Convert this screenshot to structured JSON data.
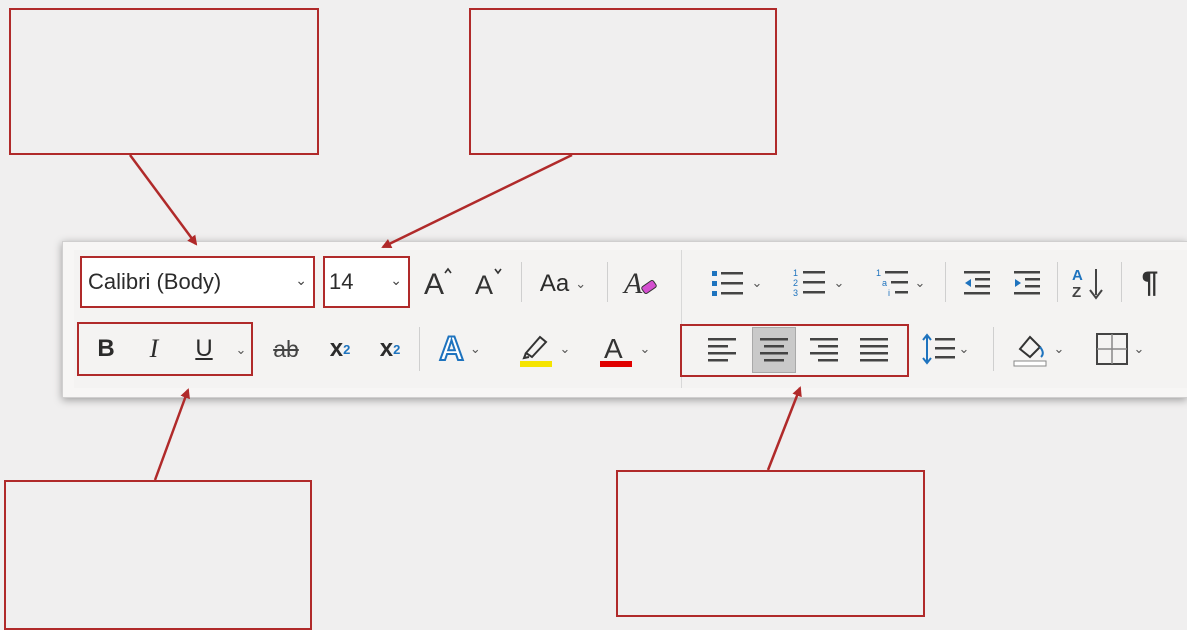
{
  "font": {
    "name": "Calibri (Body)",
    "size": "14"
  },
  "buttons": {
    "bold": "B",
    "italic": "I",
    "underline": "U",
    "strikethrough": "ab",
    "subscript": "x",
    "subscript_mark": "2",
    "superscript": "x",
    "superscript_mark": "2",
    "change_case": "Aa",
    "grow_font": "A",
    "shrink_font": "A",
    "text_effects": "A",
    "font_color": "A",
    "show_marks": "¶"
  },
  "colors": {
    "callout_border": "#b02a2a",
    "accent_blue": "#1e73be",
    "highlight_yellow": "#f5e400",
    "font_color_red": "#e00000"
  },
  "icons": [
    "chevron-down-icon",
    "grow-font-icon",
    "shrink-font-icon",
    "change-case-icon",
    "clear-formatting-icon",
    "bullets-icon",
    "numbering-icon",
    "multilevel-list-icon",
    "decrease-indent-icon",
    "increase-indent-icon",
    "sort-icon",
    "show-marks-icon",
    "strikethrough-icon",
    "subscript-icon",
    "superscript-icon",
    "text-effects-icon",
    "highlight-icon",
    "font-color-icon",
    "align-left-icon",
    "align-center-icon",
    "align-right-icon",
    "justify-icon",
    "line-spacing-icon",
    "shading-icon",
    "borders-icon"
  ],
  "state": {
    "selected_alignment": "center"
  }
}
